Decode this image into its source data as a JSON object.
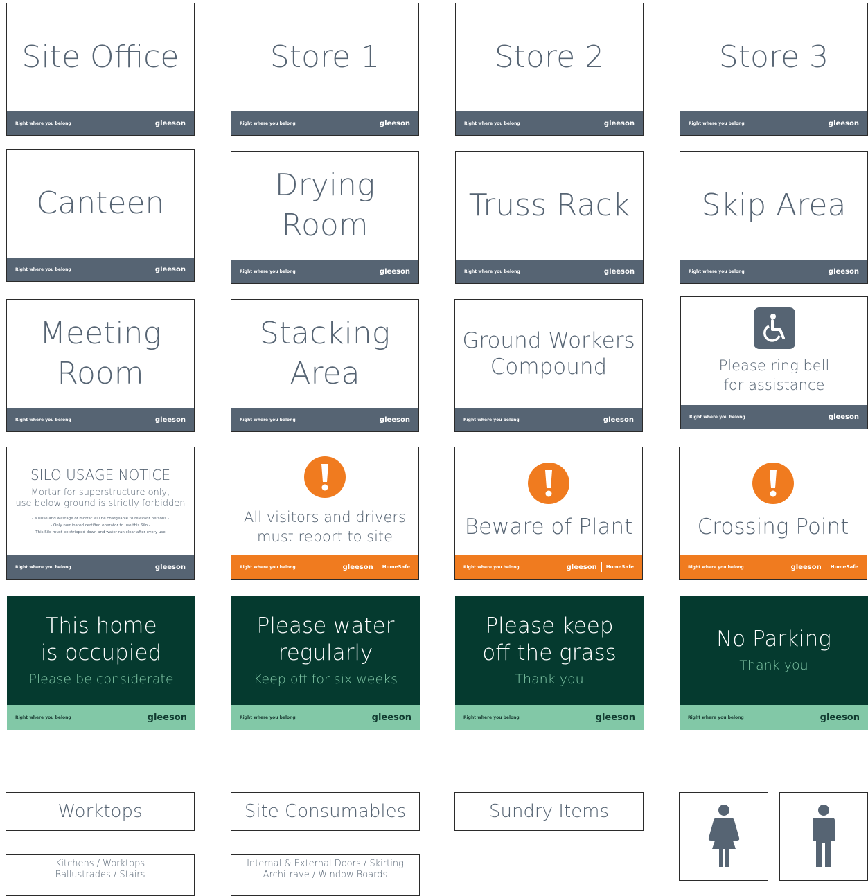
{
  "footer": {
    "tagline": "Right where you belong",
    "brand": "gleeson",
    "homesafe": "HomeSafe"
  },
  "signs": {
    "site_office": "Site Office",
    "store1": "Store 1",
    "store2": "Store 2",
    "store3": "Store 3",
    "canteen": "Canteen",
    "drying_l1": "Drying",
    "drying_l2": "Room",
    "truss_rack": "Truss Rack",
    "skip_area": "Skip Area",
    "meeting_l1": "Meeting",
    "meeting_l2": "Room",
    "stacking_l1": "Stacking",
    "stacking_l2": "Area",
    "ground_l1": "Ground Workers",
    "ground_l2": "Compound",
    "ring_l1": "Please ring bell",
    "ring_l2": "for assistance",
    "silo_title": "SILO USAGE NOTICE",
    "silo_l1": "Mortar for superstructure only,",
    "silo_l2": "use below ground is strictly forbidden",
    "silo_n1": "- Misuse and wastage of mortar will be chargeable to relevant persons -",
    "silo_n2": "- Only nominated certified operator to use this Silo -",
    "silo_n3": "- This Silo must be stripped down and water ran clear after every use -",
    "visitors_l1": "All visitors and drivers",
    "visitors_l2": "must report to site",
    "beware": "Beware of Plant",
    "crossing": "Crossing Point",
    "occupied_l1": "This home",
    "occupied_l2": "is occupied",
    "occupied_sub": "Please be considerate",
    "water_l1": "Please water",
    "water_l2": "regularly",
    "water_sub": "Keep off for six weeks",
    "grass_l1": "Please keep",
    "grass_l2": "off the grass",
    "grass_sub": "Thank you",
    "parking": "No Parking",
    "parking_sub": "Thank you"
  },
  "labels": {
    "worktops": "Worktops",
    "site_consumables": "Site Consumables",
    "sundry_items": "Sundry Items",
    "kitchens_l1": "Kitchens / Worktops",
    "kitchens_l2": "Ballustrades / Stairs",
    "doors_l1": "Internal & External Doors / Skirting",
    "doors_l2": "Architrave / Window Boards"
  },
  "icons": {
    "wheelchair": "wheelchair-icon",
    "alert": "exclamation-icon",
    "female": "female-toilet-icon",
    "male": "male-toilet-icon"
  },
  "colors": {
    "slate": "#566473",
    "orange": "#f07b1f",
    "dark_green": "#053a2f",
    "mint": "#82c8a7"
  }
}
